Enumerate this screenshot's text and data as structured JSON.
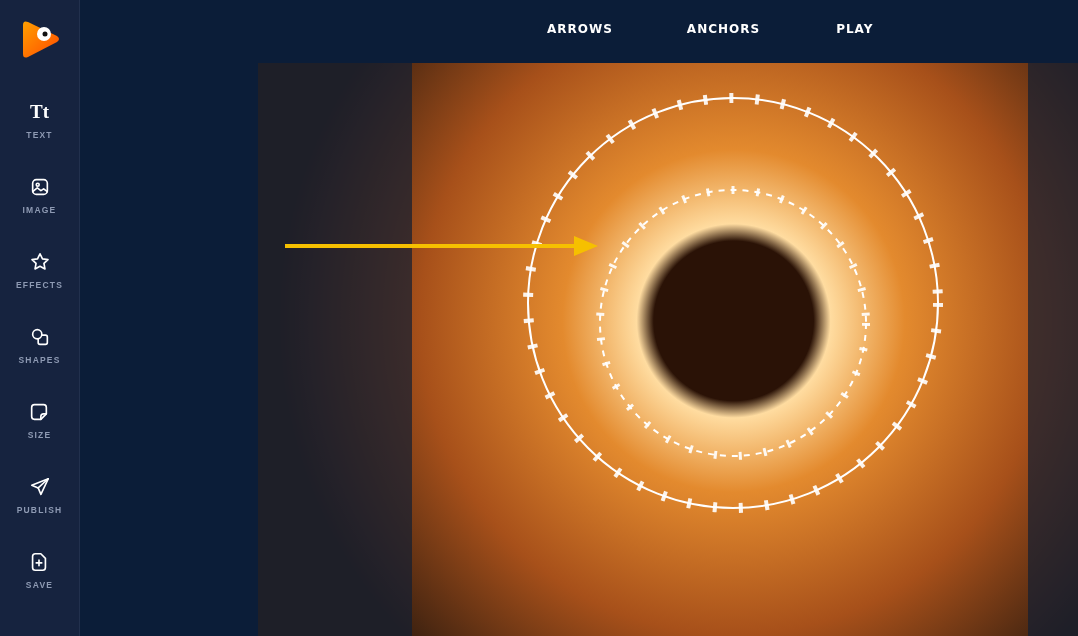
{
  "sidebar": {
    "tools": [
      {
        "kind": "text",
        "glyph": "Tt",
        "label": "TEXT"
      },
      {
        "kind": "image",
        "label": "IMAGE"
      },
      {
        "kind": "effects",
        "label": "EFFECTS"
      },
      {
        "kind": "shapes",
        "label": "SHAPES"
      },
      {
        "kind": "size",
        "label": "SIZE"
      },
      {
        "kind": "publish",
        "label": "PUBLISH"
      },
      {
        "kind": "save",
        "label": "SAVE"
      }
    ]
  },
  "nav": {
    "items": [
      "ARROWS",
      "ANCHORS",
      "PLAY"
    ]
  }
}
